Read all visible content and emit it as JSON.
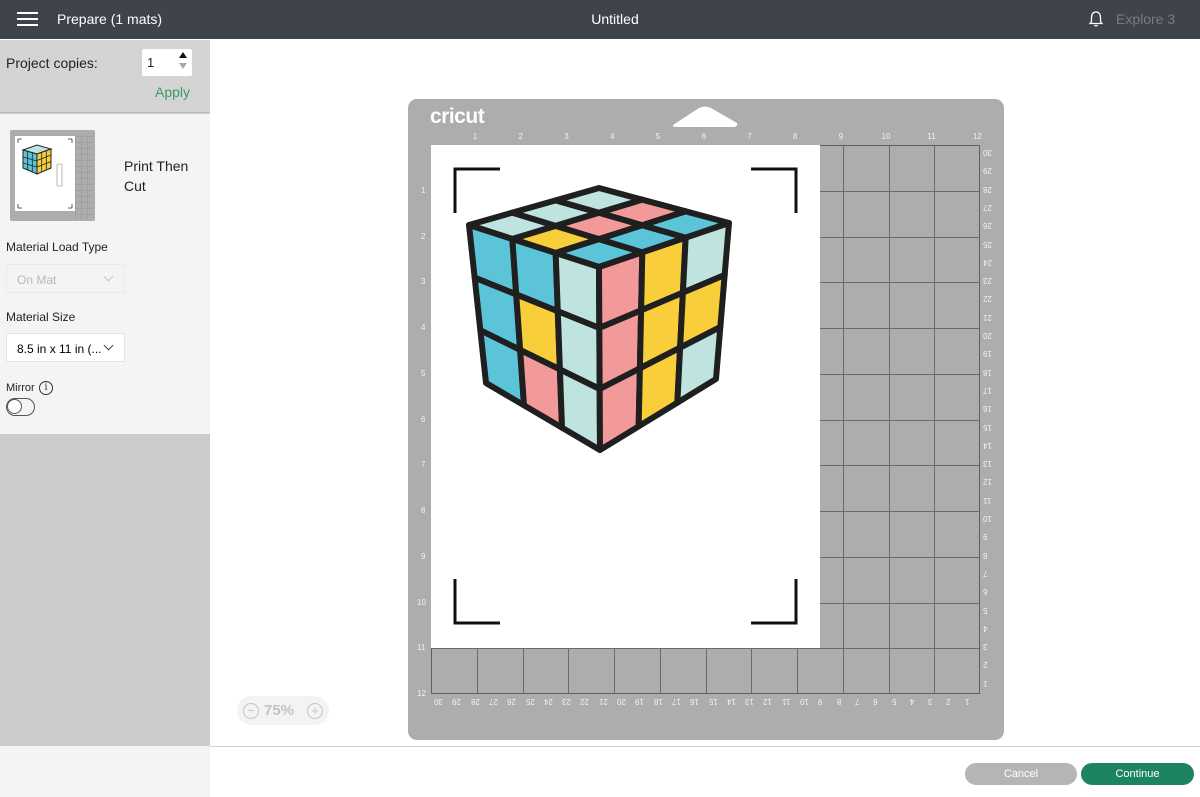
{
  "header": {
    "menu_icon": "hamburger-icon",
    "title": "Prepare (1 mats)",
    "project_name": "Untitled",
    "notification_icon": "bell-icon",
    "machine": "Explore 3"
  },
  "sidebar": {
    "copies_label": "Project copies:",
    "copies_value": "1",
    "apply_label": "Apply",
    "mat_type": "Print Then Cut",
    "material_load_type_label": "Material Load Type",
    "material_load_type_value": "On Mat",
    "material_size_label": "Material Size",
    "material_size_value": "8.5 in x 11 in (...",
    "mirror_label": "Mirror",
    "mirror_info": "i",
    "mirror_on": false
  },
  "mat": {
    "brand": "cricut",
    "top_ruler": [
      "1",
      "2",
      "3",
      "4",
      "5",
      "6",
      "7",
      "8",
      "9",
      "10",
      "11",
      "12"
    ],
    "left_ruler": [
      "1",
      "2",
      "3",
      "4",
      "5",
      "6",
      "7",
      "8",
      "9",
      "10",
      "11",
      "12"
    ],
    "right_ruler": [
      "30",
      "29",
      "28",
      "27",
      "26",
      "25",
      "24",
      "23",
      "22",
      "21",
      "20",
      "19",
      "18",
      "17",
      "16",
      "15",
      "14",
      "13",
      "12",
      "11",
      "10",
      "9",
      "8",
      "7",
      "6",
      "5",
      "4",
      "3",
      "2",
      "1"
    ],
    "bottom_ruler": [
      "30",
      "29",
      "28",
      "27",
      "26",
      "25",
      "24",
      "23",
      "22",
      "21",
      "20",
      "19",
      "18",
      "17",
      "16",
      "15",
      "14",
      "13",
      "12",
      "11",
      "10",
      "9",
      "8",
      "7",
      "6",
      "5",
      "4",
      "3",
      "2",
      "1"
    ],
    "colors": {
      "teal": "#5bc4d8",
      "mint": "#bfe4df",
      "pink": "#f29a9a",
      "yellow": "#f8cf3a",
      "outline": "#1f1f1f"
    }
  },
  "zoom": {
    "minus": "−",
    "level": "75%",
    "plus": "+"
  },
  "footer": {
    "cancel_label": "Cancel",
    "continue_label": "Continue"
  }
}
